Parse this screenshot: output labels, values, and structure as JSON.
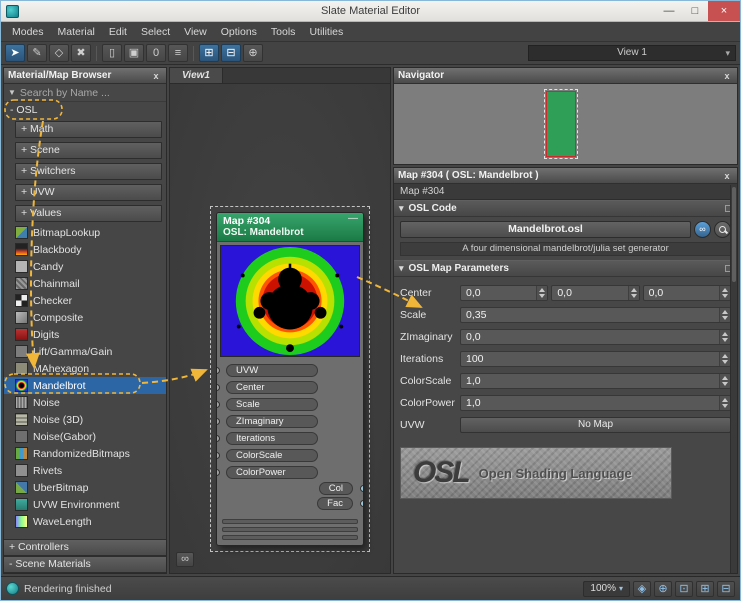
{
  "window": {
    "title": "Slate Material Editor"
  },
  "icons": {
    "minimize": "—",
    "maximize": "□",
    "close": "×",
    "panel_close": "x",
    "filter": "▼",
    "caret": "▾",
    "node_minimize": "—",
    "binoculars": "∞",
    "rollout_caret": "▾"
  },
  "menu": {
    "items": [
      "Modes",
      "Material",
      "Edit",
      "Select",
      "View",
      "Options",
      "Tools",
      "Utilities"
    ]
  },
  "toolbar": {
    "view_selector": "View 1",
    "icons": [
      {
        "name": "select-tool",
        "glyph": "➤"
      },
      {
        "name": "pick-tool",
        "glyph": "✎"
      },
      {
        "name": "move-children-tool",
        "glyph": "◇"
      },
      {
        "name": "delete-button",
        "glyph": "✖"
      },
      {
        "name": "hide-unused-slots-button",
        "glyph": "▯"
      },
      {
        "name": "show-shaded-material-button",
        "glyph": "▣"
      },
      {
        "name": "render-iterations-field",
        "glyph": "0"
      },
      {
        "name": "material-id-list",
        "glyph": "≡"
      },
      {
        "name": "layout-all-button",
        "glyph": "⊞"
      },
      {
        "name": "layout-children-button",
        "glyph": "⊟"
      },
      {
        "name": "zoom-tool",
        "glyph": "⊕"
      }
    ]
  },
  "browser": {
    "title": "Material/Map Browser",
    "search_placeholder": "Search by Name ...",
    "group": "- OSL",
    "subgroups": [
      "+ Math",
      "+ Scene",
      "+ Switchers",
      "+ UVW",
      "+ Values"
    ],
    "items": [
      {
        "label": "BitmapLookup",
        "swatch": "linear-gradient(135deg,#7fae3f 50%,#3f7fae 50%)"
      },
      {
        "label": "Blackbody",
        "swatch": "linear-gradient(180deg,#222222 40%,#d04030 70%,#ffaa00)"
      },
      {
        "label": "Candy",
        "swatch": "#b5b5b5"
      },
      {
        "label": "Chainmail",
        "swatch": "repeating-linear-gradient(45deg,#999999 0 2px,#666666 2px 4px)"
      },
      {
        "label": "Checker",
        "swatch": "conic-gradient(#eeeeee 0 25%,#222222 0 50%,#eeeeee 0 75%,#222222 0)"
      },
      {
        "label": "Composite",
        "swatch": "linear-gradient(135deg,#bbbbbb,#777777)"
      },
      {
        "label": "Digits",
        "swatch": "linear-gradient(#bb3333,#881111)"
      },
      {
        "label": "Lift/Gamma/Gain",
        "swatch": "#7d7d7d"
      },
      {
        "label": "MAhexagon",
        "swatch": "#8c8c78"
      },
      {
        "label": "Mandelbrot",
        "swatch": "radial-gradient(circle,#000000 28%,#ee3333 40%,#ffee00 50%,#33cc33 62%,#2233cc 75%)"
      },
      {
        "label": "Noise",
        "swatch": "repeating-linear-gradient(90deg,#aaaaaa 0 1px,#777777 1px 3px)"
      },
      {
        "label": "Noise (3D)",
        "swatch": "repeating-linear-gradient(0deg,#b8b8a8 0 2px,#88887a 2px 4px)"
      },
      {
        "label": "Noise(Gabor)",
        "swatch": "#6f6f6f"
      },
      {
        "label": "RandomizedBitmaps",
        "swatch": "linear-gradient(90deg,#66aa44 33%,#4499cc 33% 66%,#bb8844 66%)"
      },
      {
        "label": "Rivets",
        "swatch": "#909090"
      },
      {
        "label": "UberBitmap",
        "swatch": "linear-gradient(45deg,#77aa44 50%,#4477aa 50%)"
      },
      {
        "label": "UVW Environment",
        "swatch": "linear-gradient(#3fae9f,#2a7a6f)"
      },
      {
        "label": "WaveLength",
        "swatch": "linear-gradient(90deg,#8888ff,#88ff88,#ffff88)"
      }
    ],
    "selected_item": "Mandelbrot",
    "bottom_groups": [
      "+ Controllers",
      "- Scene Materials"
    ]
  },
  "view": {
    "tab": "View1"
  },
  "node": {
    "title": "Map #304",
    "subtitle": "OSL: Mandelbrot",
    "inputs": [
      "UVW",
      "Center",
      "Scale",
      "ZImaginary",
      "Iterations",
      "ColorScale",
      "ColorPower"
    ],
    "outputs": [
      "Col",
      "Fac"
    ]
  },
  "navigator": {
    "title": "Navigator"
  },
  "inspector": {
    "title": "Map #304  ( OSL: Mandelbrot )",
    "name_field": "Map #304",
    "code_rollout": {
      "title": "OSL Code",
      "file_button": "Mandelbrot.osl",
      "description": "A four dimensional mandelbrot/julia set generator"
    },
    "params_rollout": {
      "title": "OSL Map Parameters"
    },
    "params": [
      {
        "label": "Center",
        "values": [
          "0,0",
          "0,0",
          "0,0"
        ]
      },
      {
        "label": "Scale",
        "values": [
          "0,35"
        ]
      },
      {
        "label": "ZImaginary",
        "values": [
          "0,0"
        ]
      },
      {
        "label": "Iterations",
        "values": [
          "100"
        ]
      },
      {
        "label": "ColorScale",
        "values": [
          "1,0"
        ]
      },
      {
        "label": "ColorPower",
        "values": [
          "1,0"
        ]
      },
      {
        "label": "UVW",
        "button": "No Map"
      }
    ],
    "banner": {
      "logo": "OSL",
      "text": "Open Shading Language"
    }
  },
  "statusbar": {
    "status": "Rendering finished",
    "zoom": "100%",
    "icons": [
      {
        "name": "pan-tool-icon",
        "glyph": "◈"
      },
      {
        "name": "zoom-tool-icon",
        "glyph": "⊕"
      },
      {
        "name": "zoom-region-icon",
        "glyph": "⊡"
      },
      {
        "name": "zoom-extents-icon",
        "glyph": "⊞"
      },
      {
        "name": "zoom-extents-selected-icon",
        "glyph": "⊟"
      }
    ]
  },
  "annotation": {
    "color": "#f0b63a"
  }
}
